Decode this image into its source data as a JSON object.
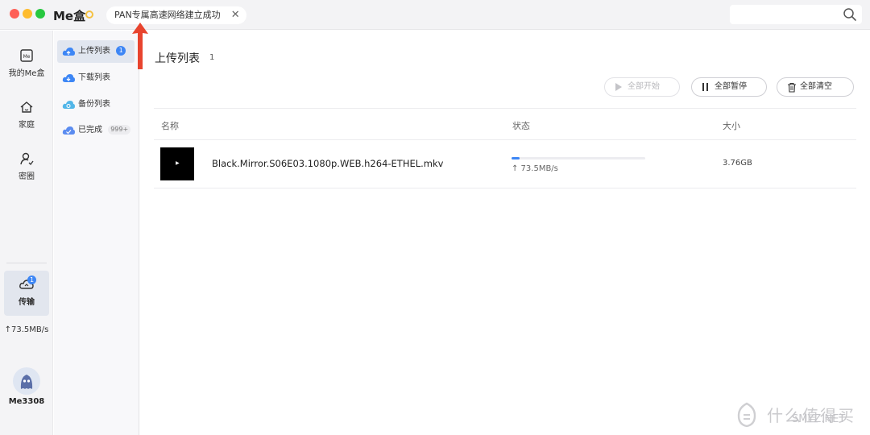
{
  "window": {
    "app_title": "Me盒",
    "notice": "PAN专属高速网络建立成功",
    "notice_close_icon": "close-icon",
    "search_placeholder": ""
  },
  "rail": {
    "items": [
      {
        "label": "我的Me盒",
        "icon": "me-box-icon"
      },
      {
        "label": "家庭",
        "icon": "home-icon"
      },
      {
        "label": "密圈",
        "icon": "circle-icon"
      }
    ],
    "transfer": {
      "label": "传输",
      "badge": "1",
      "icon": "cloud-transfer-icon"
    },
    "speed": "↑73.5MB/s",
    "user": {
      "name": "Me3308",
      "icon": "avatar"
    }
  },
  "subnav": {
    "items": [
      {
        "label": "上传列表",
        "badge": "1",
        "icon": "upload-cloud-icon",
        "active": true
      },
      {
        "label": "下载列表",
        "badge": "",
        "icon": "download-cloud-icon"
      },
      {
        "label": "备份列表",
        "badge": "",
        "icon": "backup-cloud-icon"
      },
      {
        "label": "已完成",
        "badge": "999+",
        "icon": "done-cloud-icon"
      }
    ]
  },
  "main": {
    "title": "上传列表",
    "count": "1",
    "buttons": {
      "start_all": "全部开始",
      "pause_all": "全部暂停",
      "clear_all": "全部清空"
    },
    "columns": {
      "name": "名称",
      "status": "状态",
      "size": "大小"
    },
    "rows": [
      {
        "name": "Black.Mirror.S06E03.1080p.WEB.h264-ETHEL.mkv",
        "rate": "↑ 73.5MB/s",
        "progress": 0.06,
        "size": "3.76GB"
      }
    ]
  },
  "watermark": {
    "text": "什么值得买",
    "sub": "SMYZ.NET"
  },
  "colors": {
    "accent": "#3d86f5",
    "annotation_arrow": "#e8442e"
  }
}
